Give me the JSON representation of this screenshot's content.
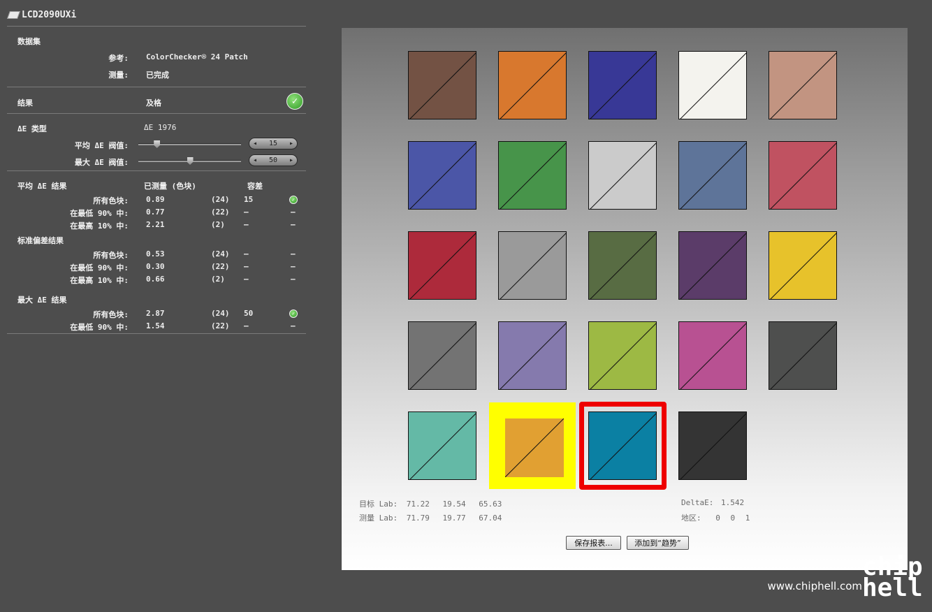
{
  "window": {
    "title": "LCD2090UXi"
  },
  "dataset": {
    "heading": "数据集",
    "reference_label": "参考:",
    "reference_value": "ColorChecker® 24 Patch",
    "measure_label": "测量:",
    "measure_value": "已完成"
  },
  "result": {
    "label": "结果",
    "value": "及格"
  },
  "delta_type": {
    "label": "ΔE 类型",
    "value": "ΔE 1976"
  },
  "thresholds": {
    "avg_label": "平均 ΔE 阀值:",
    "avg_value": "15",
    "avg_level": 0.15,
    "max_label": "最大 ΔE 阀值:",
    "max_value": "50",
    "max_level": 0.5
  },
  "table": {
    "avg_heading": "平均 ΔE 结果",
    "col_measured": "已测量 (色块)",
    "col_tolerance": "容差",
    "avg_rows": [
      {
        "label": "所有色块:",
        "value": "0.89",
        "count": "(24)",
        "tol": "15",
        "pass": true
      },
      {
        "label": "在最低 90% 中:",
        "value": "0.77",
        "count": "(22)",
        "tol": "–",
        "pass": false
      },
      {
        "label": "在最高 10% 中:",
        "value": "2.21",
        "count": "(2)",
        "tol": "–",
        "pass": false
      }
    ],
    "std_heading": "标准偏差结果",
    "std_rows": [
      {
        "label": "所有色块:",
        "value": "0.53",
        "count": "(24)",
        "tol": "–",
        "pass": false
      },
      {
        "label": "在最低 90% 中:",
        "value": "0.30",
        "count": "(22)",
        "tol": "–",
        "pass": false
      },
      {
        "label": "在最高 10% 中:",
        "value": "0.66",
        "count": "(2)",
        "tol": "–",
        "pass": false
      }
    ],
    "max_heading": "最大 ΔE 结果",
    "max_rows": [
      {
        "label": "所有色块:",
        "value": "2.87",
        "count": "(24)",
        "tol": "50",
        "pass": true
      },
      {
        "label": "在最低 90% 中:",
        "value": "1.54",
        "count": "(22)",
        "tol": "–",
        "pass": false
      }
    ],
    "dash": "–"
  },
  "patches": [
    {
      "color": "#735244"
    },
    {
      "color": "#d8782e"
    },
    {
      "color": "#383896"
    },
    {
      "color": "#f4f3ee"
    },
    {
      "color": "#c29481"
    },
    {
      "color": "#4b56a7"
    },
    {
      "color": "#47944a"
    },
    {
      "color": "#cbcbcb"
    },
    {
      "color": "#5e7499"
    },
    {
      "color": "#c05261"
    },
    {
      "color": "#ad2a3b"
    },
    {
      "color": "#9a9a9a"
    },
    {
      "color": "#586c43"
    },
    {
      "color": "#5b3c69"
    },
    {
      "color": "#e7c22b"
    },
    {
      "color": "#737373"
    },
    {
      "color": "#857aad"
    },
    {
      "color": "#9db944"
    },
    {
      "color": "#b85192"
    },
    {
      "color": "#4e4f4e"
    },
    {
      "color": "#64b9a6"
    },
    {
      "color": "#e1a032",
      "highlight": "yellow"
    },
    {
      "color": "#0b80a3",
      "highlight": "red"
    },
    {
      "color": "#343434"
    }
  ],
  "highlight_colors": {
    "yellow": "#ffff00",
    "red": "#ee0000"
  },
  "lab": {
    "target_label": "目标 Lab:",
    "target_l": "71.22",
    "target_a": "19.54",
    "target_b": "65.63",
    "measured_label": "测量 Lab:",
    "measured_l": "71.79",
    "measured_a": "19.77",
    "measured_b": "67.04",
    "delta_label": "DeltaE:",
    "delta_value": "1.542",
    "region_label": "地区:",
    "region_value": "0 0 1"
  },
  "buttons": {
    "save_report": "保存报表...",
    "add_trend": "添加到“趋势”"
  },
  "watermark": {
    "url": "www.chiphell.com",
    "logo_top": "chip",
    "logo_bottom": "hell"
  }
}
